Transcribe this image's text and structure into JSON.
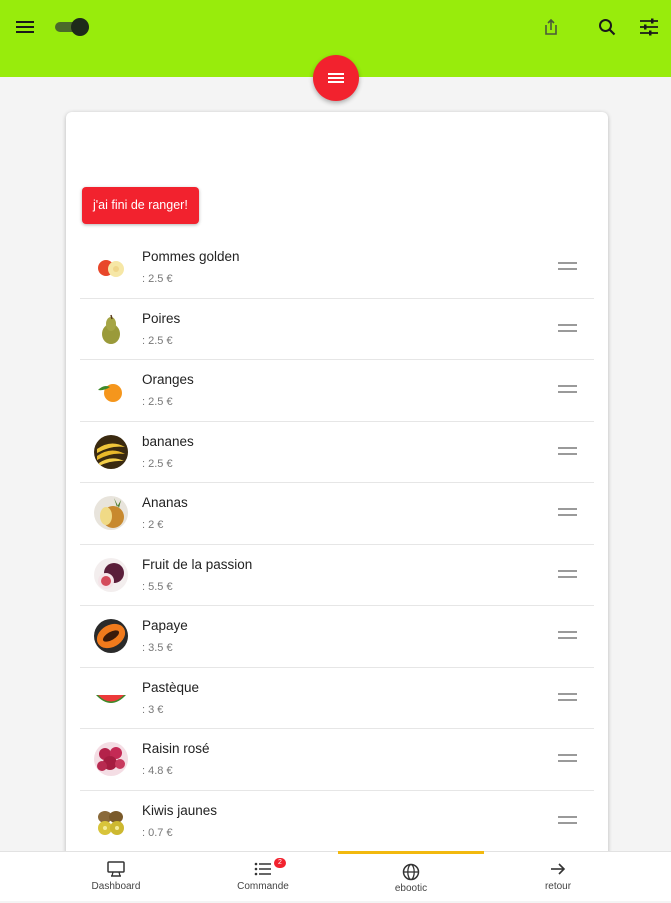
{
  "header": {
    "menu_icon": "hamburger-icon",
    "toggle_icon": "toggle-icon",
    "share_icon": "share-icon",
    "search_icon": "search-icon",
    "filter_icon": "tune-icon",
    "color": "#98ec0c"
  },
  "fab": {
    "icon": "list-icon",
    "color": "#f2222e"
  },
  "main": {
    "done_button": "j'ai fini de ranger!",
    "products": [
      {
        "name": "Pommes golden",
        "price": ": 2.5 €",
        "icon": "apple-icon"
      },
      {
        "name": "Poires",
        "price": ": 2.5 €",
        "icon": "pear-icon"
      },
      {
        "name": "Oranges",
        "price": ": 2.5 €",
        "icon": "orange-icon"
      },
      {
        "name": "bananes",
        "price": ": 2.5 €",
        "icon": "banana-icon"
      },
      {
        "name": "Ananas",
        "price": ": 2 €",
        "icon": "pineapple-icon"
      },
      {
        "name": "Fruit de la passion",
        "price": ": 5.5 €",
        "icon": "passion-fruit-icon"
      },
      {
        "name": "Papaye",
        "price": ": 3.5 €",
        "icon": "papaya-icon"
      },
      {
        "name": "Pastèque",
        "price": ": 3 €",
        "icon": "watermelon-icon"
      },
      {
        "name": "Raisin rosé",
        "price": ": 4.8 €",
        "icon": "grapes-icon"
      },
      {
        "name": "Kiwis jaunes",
        "price": ": 0.7 €",
        "icon": "kiwi-icon"
      }
    ]
  },
  "nav": {
    "items": [
      {
        "label": "Dashboard",
        "icon": "dashboard-icon"
      },
      {
        "label": "Commande",
        "icon": "order-list-icon",
        "badge": "2"
      },
      {
        "label": "ebootic",
        "icon": "globe-icon",
        "active": true
      },
      {
        "label": "retour",
        "icon": "arrow-right-icon"
      }
    ],
    "active_color": "#f2b90f"
  }
}
